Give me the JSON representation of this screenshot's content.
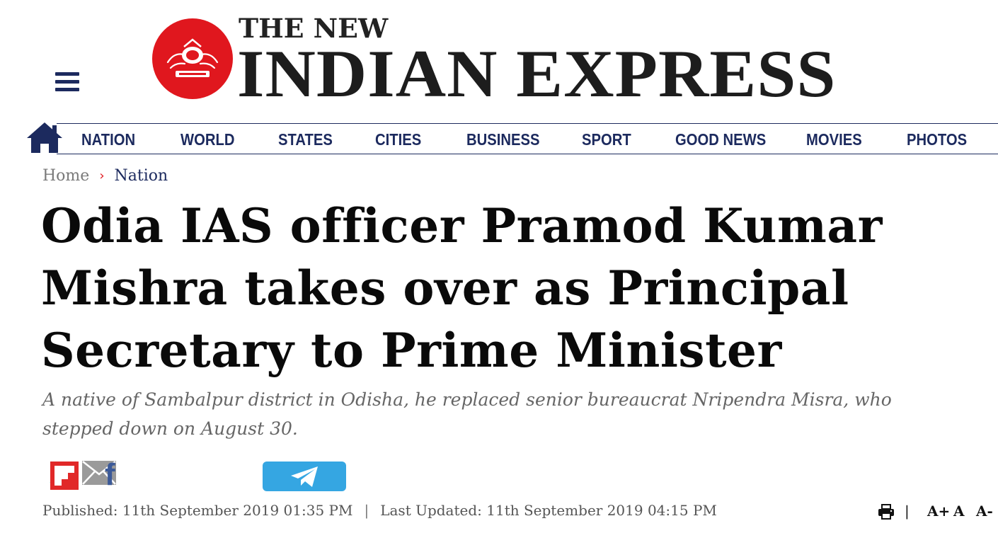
{
  "masthead": {
    "title_small": "THE NEW",
    "title_big": "INDIAN EXPRESS",
    "brand_red": "#e0171e",
    "brand_navy": "#1c2a5e"
  },
  "nav": {
    "items": [
      {
        "label": "NATION",
        "active": true
      },
      {
        "label": "WORLD",
        "active": false
      },
      {
        "label": "STATES",
        "active": false
      },
      {
        "label": "CITIES",
        "active": false
      },
      {
        "label": "BUSINESS",
        "active": false
      },
      {
        "label": "SPORT",
        "active": false
      },
      {
        "label": "GOOD NEWS",
        "active": false
      },
      {
        "label": "MOVIES",
        "active": false
      },
      {
        "label": "PHOTOS",
        "active": false
      }
    ]
  },
  "breadcrumb": {
    "home": "Home",
    "separator": "›",
    "section": "Nation"
  },
  "article": {
    "headline_lines": [
      "Odia IAS officer Pramod Kumar",
      "Mishra takes over as Principal",
      "Secretary to Prime Minister"
    ],
    "summary": "A native of Sambalpur district in Odisha, he replaced senior bureaucrat Nripendra Misra, who stepped down on August 30.",
    "published": "Published: 11th September 2019 01:35 PM",
    "divider": "|",
    "updated": "Last Updated: 11th September 2019 04:15 PM"
  },
  "share": {
    "icons": [
      "flipboard-icon",
      "facebook-icon",
      "twitter-icon",
      "mail-icon",
      "telegram-icon"
    ],
    "facebook_glyph": "f"
  },
  "tools": {
    "divider": "|",
    "font_increase": "A+",
    "font_reset": "A",
    "font_decrease": "A-"
  }
}
